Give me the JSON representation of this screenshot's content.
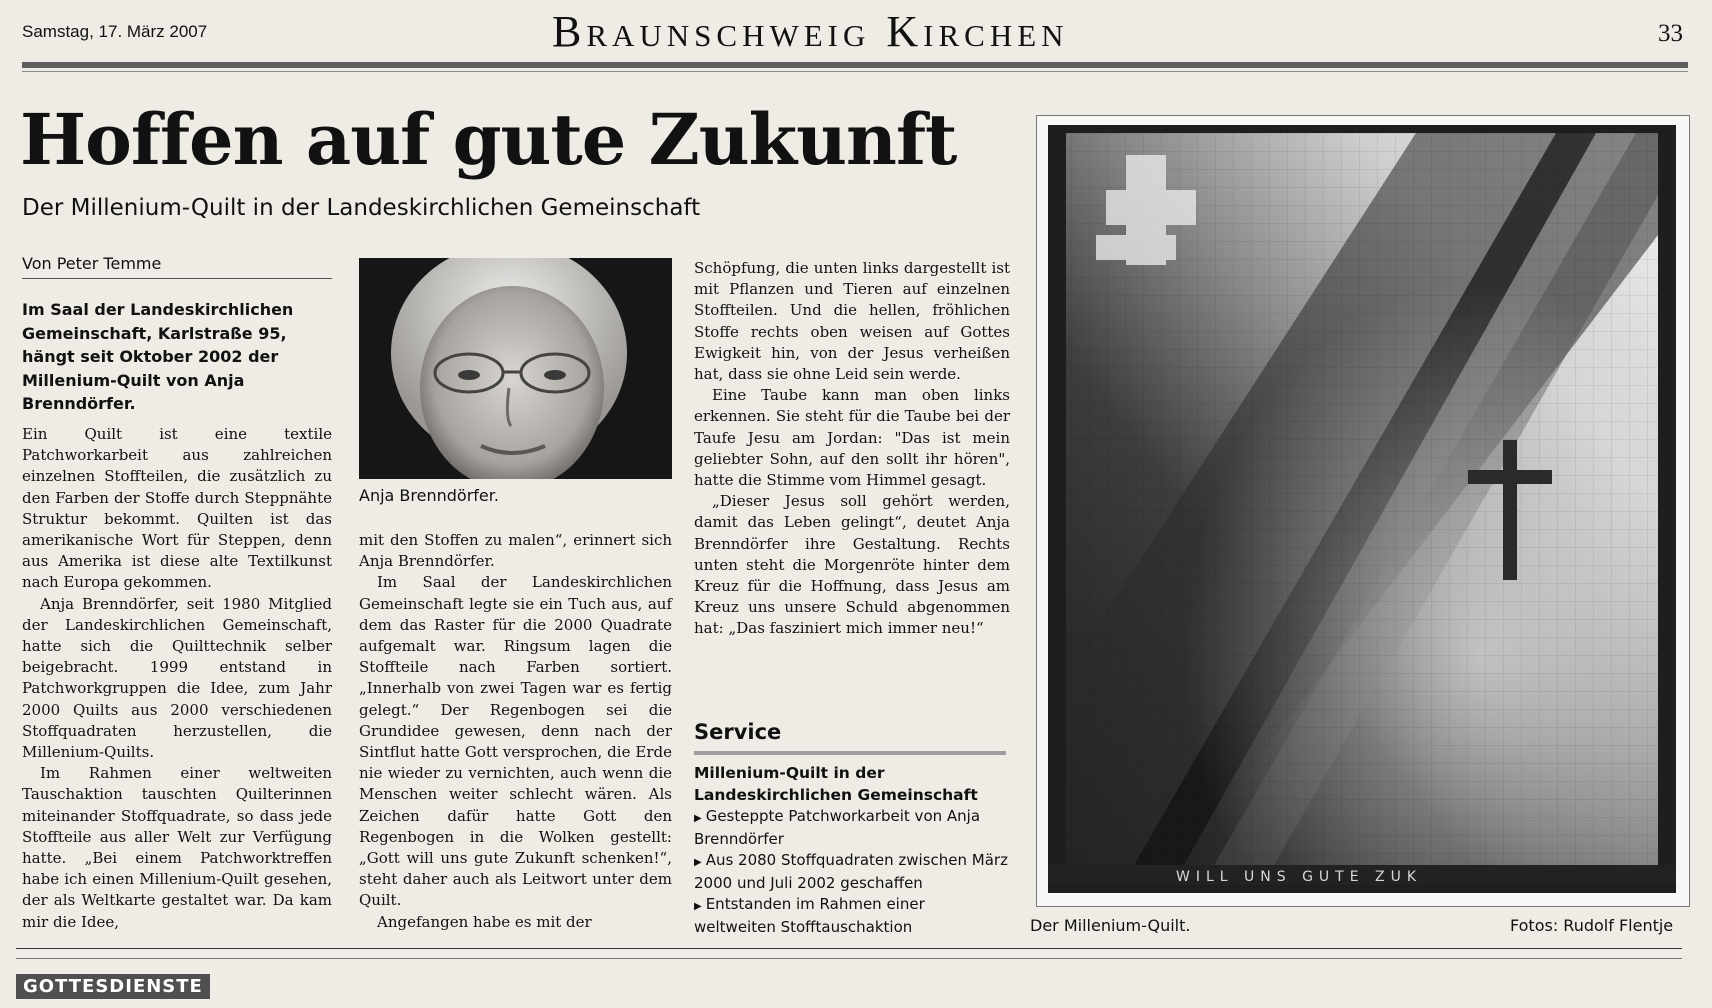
{
  "header": {
    "date": "Samstag, 17. März 2007",
    "section": "Braunschweig Kirchen",
    "page_number": "33"
  },
  "article": {
    "headline": "Hoffen auf gute Zukunft",
    "subheadline": "Der Millenium-Quilt in der Landeskirchlichen Gemeinschaft",
    "byline": "Von Peter Temme",
    "lead": "Im Saal der Landeskirchlichen Gemeinschaft, Karlstraße 95, hängt seit Oktober 2002 der Millenium-Quilt von Anja Brenndörfer.",
    "col1": [
      "Ein Quilt ist eine textile Patchworkarbeit aus zahlreichen einzelnen Stoffteilen, die zusätzlich zu den Farben der Stoffe durch Steppnähte Struktur bekommt. Quilten ist das amerikanische Wort für Steppen, denn aus Amerika ist diese alte Textilkunst nach Europa gekommen.",
      "Anja Brenndörfer, seit 1980 Mitglied der Landeskirchlichen Gemeinschaft, hatte sich die Quilttechnik selber beigebracht. 1999 entstand in Patchworkgruppen die Idee, zum Jahr 2000 Quilts aus 2000 verschiedenen Stoffquadraten herzustellen, die Millenium-Quilts.",
      "Im Rahmen einer weltweiten Tauschaktion tauschten Quilterinnen miteinander Stoffquadrate, so dass jede Stoffteile aus aller Welt zur Verfügung hatte. „Bei einem Patchworktreffen habe ich einen Millenium-Quilt gesehen, der als Weltkarte gestaltet war. Da kam mir die Idee,"
    ],
    "col2": [
      "mit den Stoffen zu malen“, erinnert sich Anja Brenndörfer.",
      "Im Saal der Landeskirchlichen Gemeinschaft legte sie ein Tuch aus, auf dem das Raster für die 2000 Quadrate aufgemalt war. Ringsum lagen die Stoffteile nach Farben sortiert. „Innerhalb von zwei Tagen war es fertig gelegt.“ Der Regenbogen sei die Grundidee gewesen, denn nach der Sintflut hatte Gott versprochen, die Erde nie wieder zu vernichten, auch wenn die Menschen weiter schlecht wären. Als Zeichen dafür hatte Gott den Regenbogen in die Wolken gestellt: „Gott will uns gute Zukunft schenken!“, steht daher auch als Leitwort unter dem Quilt.",
      "Angefangen habe es mit der"
    ],
    "col3": [
      "Schöpfung, die unten links dargestellt ist mit Pflanzen und Tieren auf einzelnen Stoffteilen. Und die hellen, fröhlichen Stoffe rechts oben weisen auf Gottes Ewigkeit hin, von der Jesus verheißen hat, dass sie ohne Leid sein werde.",
      "Eine Taube kann man oben links erkennen. Sie steht für die Taube bei der Taufe Jesu am Jordan: \"Das ist mein geliebter Sohn, auf den sollt ihr hören\", hatte die Stimme vom Himmel gesagt.",
      "„Dieser Jesus soll gehört werden, damit das Leben gelingt“, deutet Anja Brenndörfer ihre Gestaltung. Rechts unten steht die Morgenröte hinter dem Kreuz für die Hoffnung, dass Jesus am Kreuz uns unsere Schuld abgenommen hat: „Das fasziniert mich immer neu!“"
    ],
    "portrait_caption": "Anja Brenndörfer.",
    "quilt_caption": "Der Millenium-Quilt.",
    "photo_credit": "Fotos: Rudolf Flentje",
    "quilt_inscription": "WILL UNS GUTE ZUK"
  },
  "service": {
    "title": "Service",
    "heading": "Millenium-Quilt in der Landeskirchlichen Gemeinschaft",
    "items": [
      "Gesteppte Patchworkarbeit von Anja Brenndörfer",
      "Aus 2080 Stoffquadraten zwischen März 2000 und Juli 2002 geschaffen",
      "Entstanden im Rahmen einer weltweiten Stofftauschaktion"
    ]
  },
  "footer": {
    "section_label": "GOTTESDIENSTE"
  }
}
